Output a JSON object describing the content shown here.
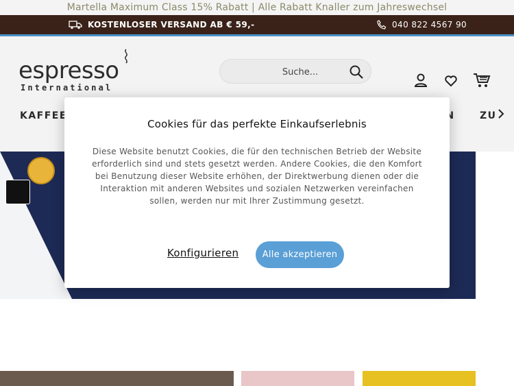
{
  "promo": {
    "text": "Martella Maximum Class 15% Rabatt | Alle Rabatt Knaller zum Jahreswechsel"
  },
  "topbar": {
    "shipping": "KOSTENLOSER VERSAND AB € 59,-",
    "phone": "040 822 4567 90"
  },
  "logo": {
    "word": "espresso",
    "sub": "International"
  },
  "search": {
    "placeholder": "Suche..."
  },
  "nav": {
    "items": [
      "KAFFEES",
      "LN",
      "ZU"
    ]
  },
  "cookie": {
    "title": "Cookies für das perfekte Einkaufserlebnis",
    "body": "Diese Website benutzt Cookies, die für den technischen Betrieb der Website erforderlich sind und stets gesetzt werden. Andere Cookies, die den Komfort bei Benutzung dieser Website erhöhen, der Direktwerbung dienen oder die Interaktion mit anderen Websites und sozialen Netzwerken vereinfachen sollen, werden nur mit Ihrer Zustimmung gesetzt.",
    "configure": "Konfigurieren",
    "accept": "Alle akzeptieren"
  },
  "colors": {
    "topbar": "#3a2218",
    "accent": "#5a9fd6",
    "hero": "#1d2a55"
  }
}
